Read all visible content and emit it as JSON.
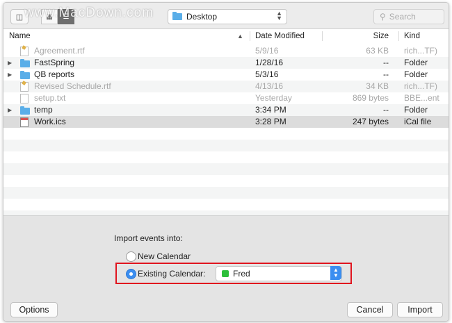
{
  "toolbar": {
    "watermark": "www.MacDown.com",
    "location_label": "Desktop",
    "search_placeholder": "Search"
  },
  "columns": {
    "name": "Name",
    "date": "Date Modified",
    "size": "Size",
    "kind": "Kind"
  },
  "files": [
    {
      "name": "Agreement.rtf",
      "date": "5/9/16",
      "size": "63 KB",
      "kind": "rich...TF)"
    },
    {
      "name": "FastSpring",
      "date": "1/28/16",
      "size": "--",
      "kind": "Folder"
    },
    {
      "name": "QB reports",
      "date": "5/3/16",
      "size": "--",
      "kind": "Folder"
    },
    {
      "name": "Revised Schedule.rtf",
      "date": "4/13/16",
      "size": "34 KB",
      "kind": "rich...TF)"
    },
    {
      "name": "setup.txt",
      "date": "Yesterday",
      "size": "869 bytes",
      "kind": "BBE...ent"
    },
    {
      "name": "temp",
      "date": "3:34 PM",
      "size": "--",
      "kind": "Folder"
    },
    {
      "name": "Work.ics",
      "date": "3:28 PM",
      "size": "247 bytes",
      "kind": "iCal file"
    }
  ],
  "import": {
    "label": "Import events into:",
    "new_calendar": "New Calendar",
    "existing_calendar": "Existing Calendar:",
    "selected_calendar": "Fred",
    "calendar_color": "#2dbf3a"
  },
  "buttons": {
    "options": "Options",
    "cancel": "Cancel",
    "import": "Import"
  }
}
